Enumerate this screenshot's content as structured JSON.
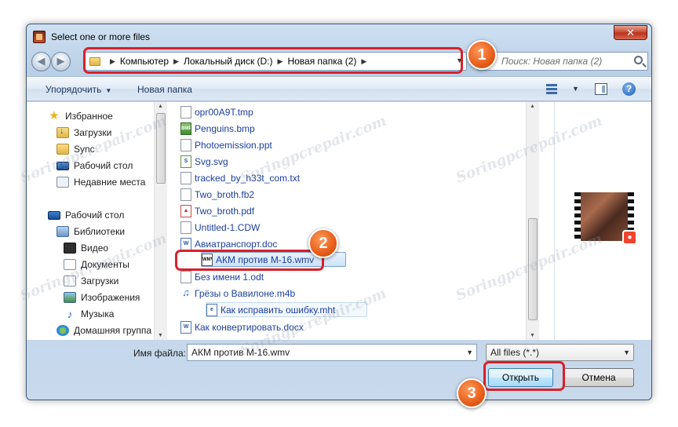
{
  "window": {
    "title": "Select one or more files",
    "close_label": "✕"
  },
  "address_bar": {
    "crumbs": [
      "Компьютер",
      "Локальный диск (D:)",
      "Новая папка (2)"
    ]
  },
  "search": {
    "prefix": "Поиск:",
    "text": "Новая папка (2)"
  },
  "toolbar": {
    "organize_label": "Упорядочить",
    "new_folder_label": "Новая папка",
    "help_label": "?"
  },
  "sidebar": {
    "items": [
      {
        "label": "Избранное",
        "icon": "star-icon"
      },
      {
        "label": "Загрузки",
        "icon": "downloads-folder-icon"
      },
      {
        "label": "Sync",
        "icon": "folder-icon"
      },
      {
        "label": "Рабочий стол",
        "icon": "desktop-icon"
      },
      {
        "label": "Недавние места",
        "icon": "recent-places-icon"
      },
      {
        "label": "Рабочий стол",
        "icon": "desktop-icon"
      },
      {
        "label": "Библиотеки",
        "icon": "libraries-icon"
      },
      {
        "label": "Видео",
        "icon": "video-library-icon"
      },
      {
        "label": "Документы",
        "icon": "documents-library-icon"
      },
      {
        "label": "Загрузки",
        "icon": "downloads-library-icon"
      },
      {
        "label": "Изображения",
        "icon": "images-library-icon"
      },
      {
        "label": "Музыка",
        "icon": "music-library-icon"
      },
      {
        "label": "Домашняя группа",
        "icon": "homegroup-icon"
      }
    ]
  },
  "files": [
    {
      "name": "opr00A9T.tmp",
      "icon": "tmp-file-icon"
    },
    {
      "name": "Penguins.bmp",
      "icon": "bmp-file-icon"
    },
    {
      "name": "Photoemission.ppt",
      "icon": "ppt-file-icon"
    },
    {
      "name": "Svg.svg",
      "icon": "svg-file-icon"
    },
    {
      "name": "tracked_by_h33t_com.txt",
      "icon": "txt-file-icon"
    },
    {
      "name": "Two_broth.fb2",
      "icon": "fb2-file-icon"
    },
    {
      "name": "Two_broth.pdf",
      "icon": "pdf-file-icon"
    },
    {
      "name": "Untitled-1.CDW",
      "icon": "cdw-file-icon"
    },
    {
      "name": "Авиатранспорт.doc",
      "icon": "word-file-icon"
    },
    {
      "name": "АКМ против М-16.wmv",
      "icon": "wmv-file-icon"
    },
    {
      "name": "Без имени 1.odt",
      "icon": "odt-file-icon"
    },
    {
      "name": "Грёзы о Вавилоне.m4b",
      "icon": "audio-file-icon"
    },
    {
      "name": "Как исправить ошибку.mht",
      "icon": "mht-file-icon"
    },
    {
      "name": "Как конвертировать.docx",
      "icon": "word-file-icon"
    }
  ],
  "selected_file_index": 9,
  "bottom": {
    "filename_label": "Имя файла:",
    "filename_value": "АКМ против М-16.wmv",
    "filetype_value": "All files (*.*)",
    "open_label": "Открыть",
    "cancel_label": "Отмена"
  },
  "callouts": {
    "one": "1",
    "two": "2",
    "three": "3"
  },
  "watermark": "Soringpcrepair.com",
  "colors": {
    "callout_red": "#d8212b",
    "badge_orange": "#e85d1a",
    "link_blue": "#1a3f9e"
  }
}
